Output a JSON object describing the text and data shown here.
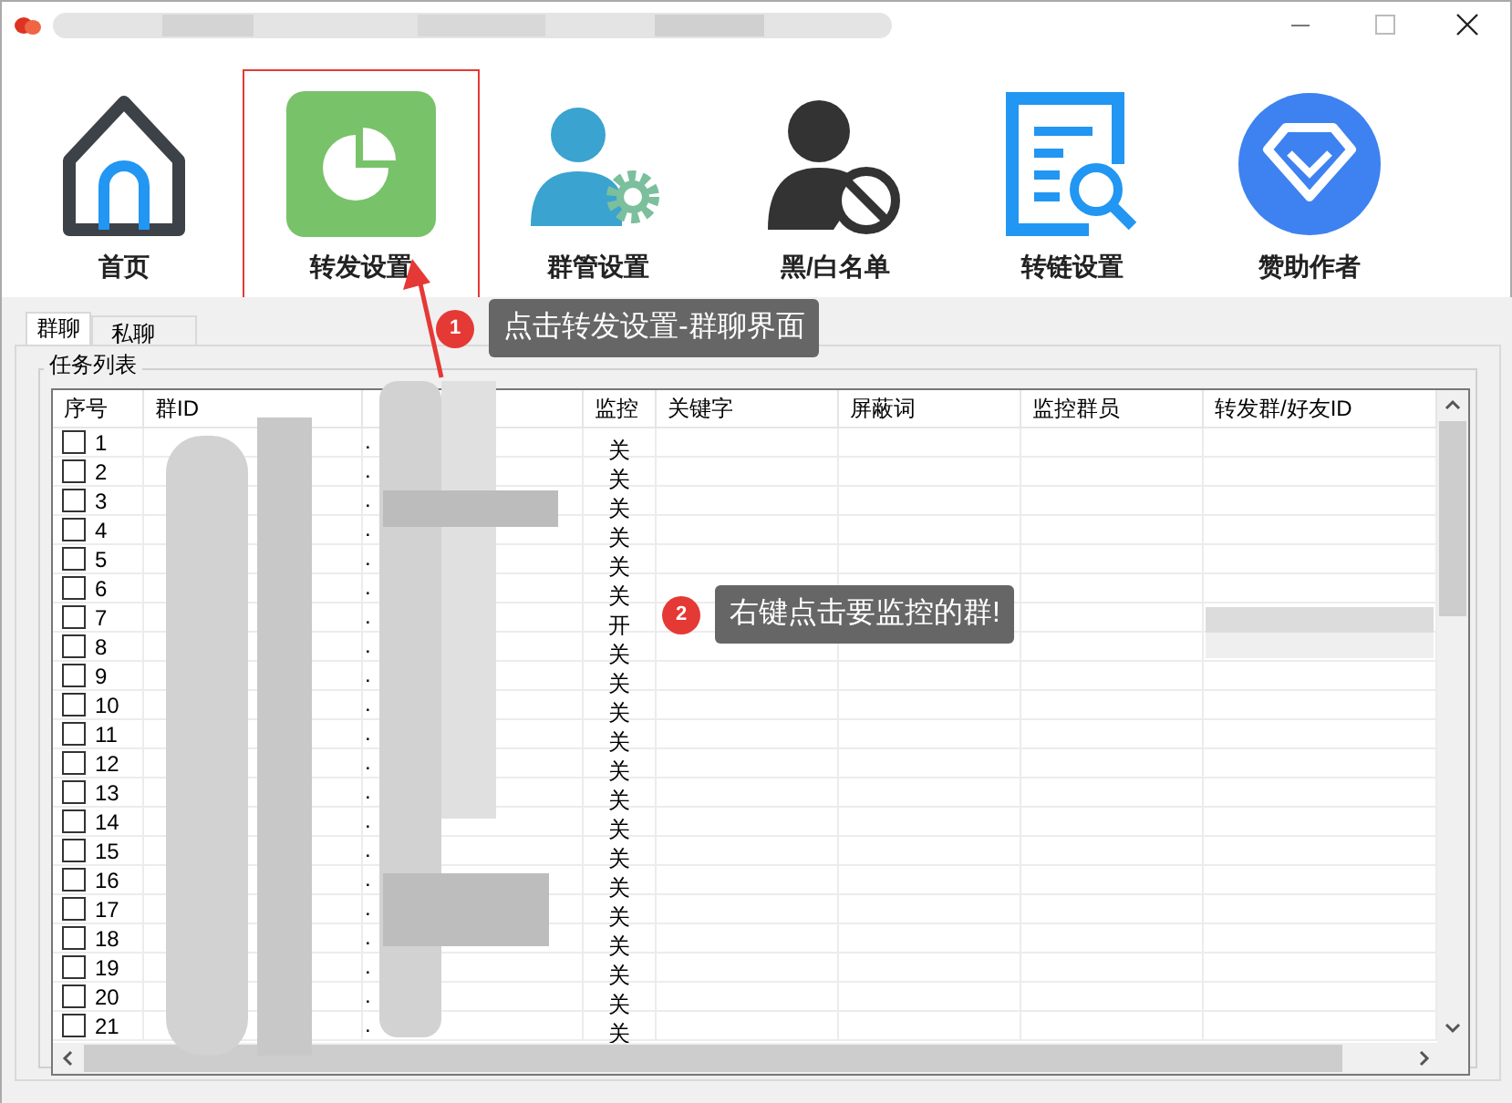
{
  "toolbar": [
    {
      "kind": "home",
      "label": "首页",
      "selected": false
    },
    {
      "kind": "pie",
      "label": "转发设置",
      "selected": true
    },
    {
      "kind": "admin",
      "label": "群管设置",
      "selected": false
    },
    {
      "kind": "block",
      "label": "黑/白名单",
      "selected": false
    },
    {
      "kind": "doc",
      "label": "转链设置",
      "selected": false
    },
    {
      "kind": "diamond",
      "label": "赞助作者",
      "selected": false
    }
  ],
  "callouts": [
    {
      "number": "1",
      "text": "点击转发设置-群聊界面"
    },
    {
      "number": "2",
      "text": "右键点击要监控的群!"
    }
  ],
  "tabs": [
    {
      "label": "群聊",
      "selected": true
    },
    {
      "label": "私聊",
      "selected": false
    }
  ],
  "group_title": "任务列表",
  "table": {
    "columns": [
      "序号",
      "群ID",
      "",
      "监控",
      "关键字",
      "屏蔽词",
      "监控群员",
      "转发群/好友ID"
    ],
    "rows": [
      {
        "checked": false,
        "index": "1",
        "column_3": ".",
        "monitor": "关"
      },
      {
        "checked": false,
        "index": "2",
        "column_3": ".",
        "monitor": "关"
      },
      {
        "checked": false,
        "index": "3",
        "column_3": ".",
        "monitor": "关"
      },
      {
        "checked": false,
        "index": "4",
        "column_3": ".",
        "monitor": "关"
      },
      {
        "checked": false,
        "index": "5",
        "column_3": ".",
        "monitor": "关"
      },
      {
        "checked": false,
        "index": "6",
        "column_3": ".",
        "monitor": "关"
      },
      {
        "checked": false,
        "index": "7",
        "column_3": ".",
        "monitor": "开"
      },
      {
        "checked": false,
        "index": "8",
        "column_3": ".",
        "monitor": "关"
      },
      {
        "checked": false,
        "index": "9",
        "column_3": ".",
        "monitor": "关"
      },
      {
        "checked": false,
        "index": "10",
        "column_3": ".",
        "monitor": "关"
      },
      {
        "checked": false,
        "index": "11",
        "column_3": ".",
        "monitor": "关"
      },
      {
        "checked": false,
        "index": "12",
        "column_3": ".",
        "monitor": "关"
      },
      {
        "checked": false,
        "index": "13",
        "column_3": ".",
        "monitor": "关"
      },
      {
        "checked": false,
        "index": "14",
        "column_3": ".",
        "monitor": "关"
      },
      {
        "checked": false,
        "index": "15",
        "column_3": ".",
        "monitor": "关"
      },
      {
        "checked": false,
        "index": "16",
        "column_3": ".",
        "monitor": "关"
      },
      {
        "checked": false,
        "index": "17",
        "column_3": ".",
        "monitor": "关"
      },
      {
        "checked": false,
        "index": "18",
        "column_3": ".",
        "monitor": "关"
      },
      {
        "checked": false,
        "index": "19",
        "column_3": ".",
        "monitor": "关"
      },
      {
        "checked": false,
        "index": "20",
        "column_3": ".",
        "monitor": "关"
      },
      {
        "checked": false,
        "index": "21",
        "column_3": ".",
        "monitor": "关"
      }
    ]
  }
}
